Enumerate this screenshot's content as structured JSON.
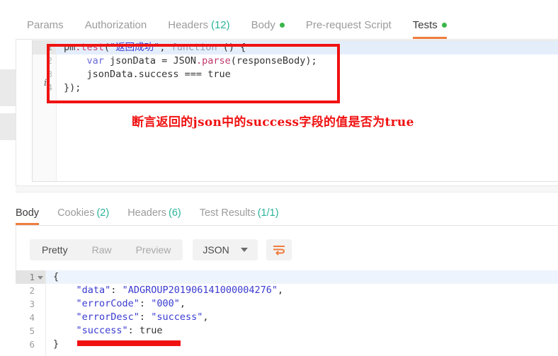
{
  "request_tabs": [
    {
      "label": "Params",
      "count": "",
      "dot": false,
      "active": false
    },
    {
      "label": "Authorization",
      "count": "",
      "dot": false,
      "active": false
    },
    {
      "label": "Headers",
      "count": "(12)",
      "dot": false,
      "active": false
    },
    {
      "label": "Body",
      "count": "",
      "dot": true,
      "active": false
    },
    {
      "label": "Pre-request Script",
      "count": "",
      "dot": false,
      "active": false
    },
    {
      "label": "Tests",
      "count": "",
      "dot": true,
      "active": true
    }
  ],
  "script_editor": {
    "gutter": [
      "1",
      "2",
      "3",
      "4"
    ],
    "info_marker": "i",
    "lines": [
      [
        {
          "t": "pm",
          "c": "tok-plain"
        },
        {
          "t": ".test",
          "c": "tok-prop"
        },
        {
          "t": "(",
          "c": "tok-plain"
        },
        {
          "t": "\"返回成功\"",
          "c": "tok-str"
        },
        {
          "t": ", ",
          "c": "tok-plain"
        },
        {
          "t": "function",
          "c": "tok-fn"
        },
        {
          "t": " () {",
          "c": "tok-plain"
        }
      ],
      [
        {
          "t": "    ",
          "c": "tok-plain"
        },
        {
          "t": "var",
          "c": "tok-kw"
        },
        {
          "t": " jsonData = ",
          "c": "tok-plain"
        },
        {
          "t": "JSON",
          "c": "tok-plain"
        },
        {
          "t": ".parse",
          "c": "tok-prop"
        },
        {
          "t": "(responseBody);",
          "c": "tok-plain"
        }
      ],
      [
        {
          "t": "    jsonData.success === true",
          "c": "tok-plain"
        }
      ],
      [
        {
          "t": "});",
          "c": "tok-plain"
        }
      ]
    ]
  },
  "annotation": {
    "text": "断言返回的json中的success字段的值是否为true",
    "color": "#f01212"
  },
  "response_tabs": [
    {
      "label": "Body",
      "count": "",
      "active": true
    },
    {
      "label": "Cookies",
      "count": "(2)",
      "active": false
    },
    {
      "label": "Headers",
      "count": "(6)",
      "active": false
    },
    {
      "label": "Test Results",
      "count": "(1/1)",
      "active": false
    }
  ],
  "view_toolbar": {
    "modes": [
      {
        "label": "Pretty",
        "active": true
      },
      {
        "label": "Raw",
        "active": false
      },
      {
        "label": "Preview",
        "active": false
      }
    ],
    "format": "JSON",
    "wrap_icon": "word-wrap-icon"
  },
  "response_body": {
    "gutter": [
      "1",
      "2",
      "3",
      "4",
      "5",
      "6"
    ],
    "lines": [
      [
        {
          "t": "{",
          "c": "j-pun"
        }
      ],
      [
        {
          "t": "    ",
          "c": "j-pun"
        },
        {
          "t": "\"data\"",
          "c": "j-key"
        },
        {
          "t": ": ",
          "c": "j-pun"
        },
        {
          "t": "\"ADGROUP201906141000004276\"",
          "c": "j-str"
        },
        {
          "t": ",",
          "c": "j-pun"
        }
      ],
      [
        {
          "t": "    ",
          "c": "j-pun"
        },
        {
          "t": "\"errorCode\"",
          "c": "j-key"
        },
        {
          "t": ": ",
          "c": "j-pun"
        },
        {
          "t": "\"000\"",
          "c": "j-str"
        },
        {
          "t": ",",
          "c": "j-pun"
        }
      ],
      [
        {
          "t": "    ",
          "c": "j-pun"
        },
        {
          "t": "\"errorDesc\"",
          "c": "j-key"
        },
        {
          "t": ": ",
          "c": "j-pun"
        },
        {
          "t": "\"success\"",
          "c": "j-str"
        },
        {
          "t": ",",
          "c": "j-pun"
        }
      ],
      [
        {
          "t": "    ",
          "c": "j-pun"
        },
        {
          "t": "\"success\"",
          "c": "j-key"
        },
        {
          "t": ": ",
          "c": "j-pun"
        },
        {
          "t": "true",
          "c": "j-bool"
        }
      ],
      [
        {
          "t": "}",
          "c": "j-pun"
        }
      ]
    ]
  },
  "colors": {
    "accent_orange": "#f07d40",
    "count_green": "#2bb39b",
    "status_dot_green": "#3bb54a",
    "annotation_red": "#f01212",
    "active_line_blue": "#e4eefb"
  }
}
